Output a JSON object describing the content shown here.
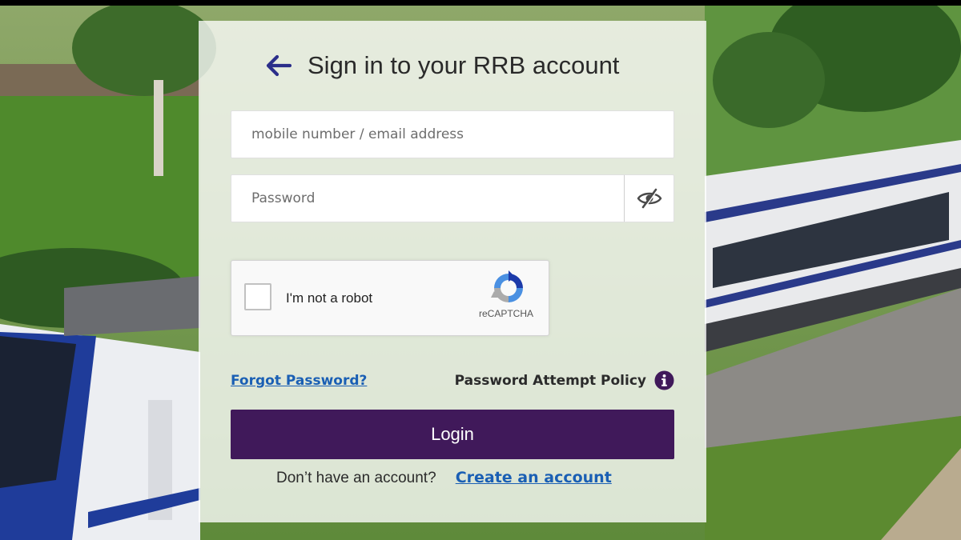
{
  "page": {
    "title": "Sign in to your RRB account"
  },
  "form": {
    "username_placeholder": "mobile number / email address",
    "username_value": "",
    "password_placeholder": "Password",
    "password_value": ""
  },
  "captcha": {
    "label": "I'm not a robot",
    "brand": "reCAPTCHA",
    "checked": false
  },
  "links": {
    "forgot_password": "Forgot Password?",
    "policy_label": "Password Attempt Policy",
    "signup_prompt": "Don’t have an account?",
    "signup_link": "Create an account"
  },
  "buttons": {
    "login": "Login"
  },
  "icons": {
    "back": "arrow-left-icon",
    "password_toggle": "eye-slash-icon",
    "info": "info-icon",
    "recaptcha": "recaptcha-logo-icon"
  },
  "colors": {
    "accent": "#40195a",
    "link": "#1a5fb4",
    "back_arrow": "#2b2e8a"
  }
}
